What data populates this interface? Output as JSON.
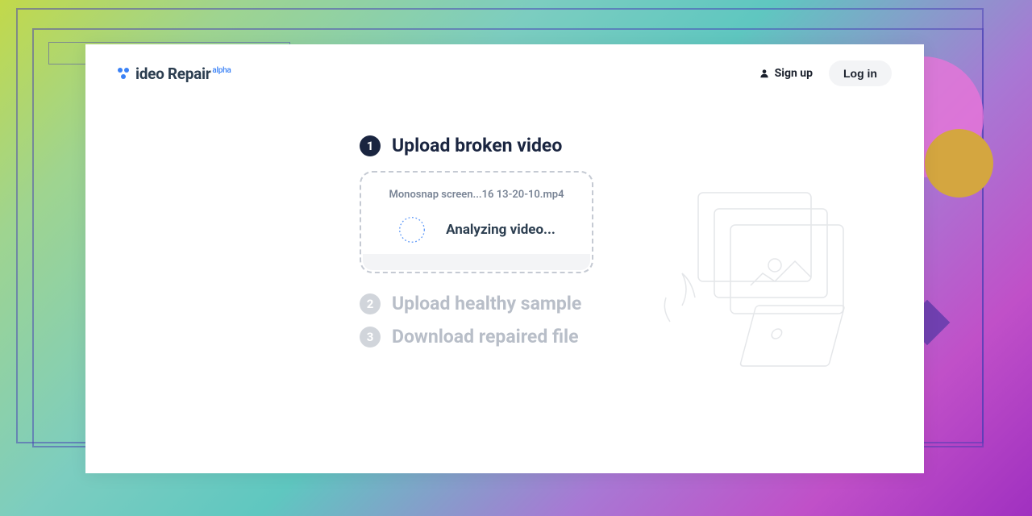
{
  "header": {
    "logo": {
      "text": "ideo Repair",
      "badge": "alpha"
    },
    "nav": {
      "signup_label": "Sign up",
      "login_label": "Log in"
    }
  },
  "steps": {
    "step1": {
      "number": "1",
      "title": "Upload broken video",
      "active": true
    },
    "step2": {
      "number": "2",
      "title": "Upload healthy sample",
      "active": false
    },
    "step3": {
      "number": "3",
      "title": "Download repaired file",
      "active": false
    }
  },
  "upload": {
    "filename": "Monosnap screen...16 13-20-10.mp4",
    "status": "Analyzing video..."
  },
  "colors": {
    "primary": "#1a2540",
    "accent": "#3b82f6",
    "muted": "#b8bec8"
  }
}
